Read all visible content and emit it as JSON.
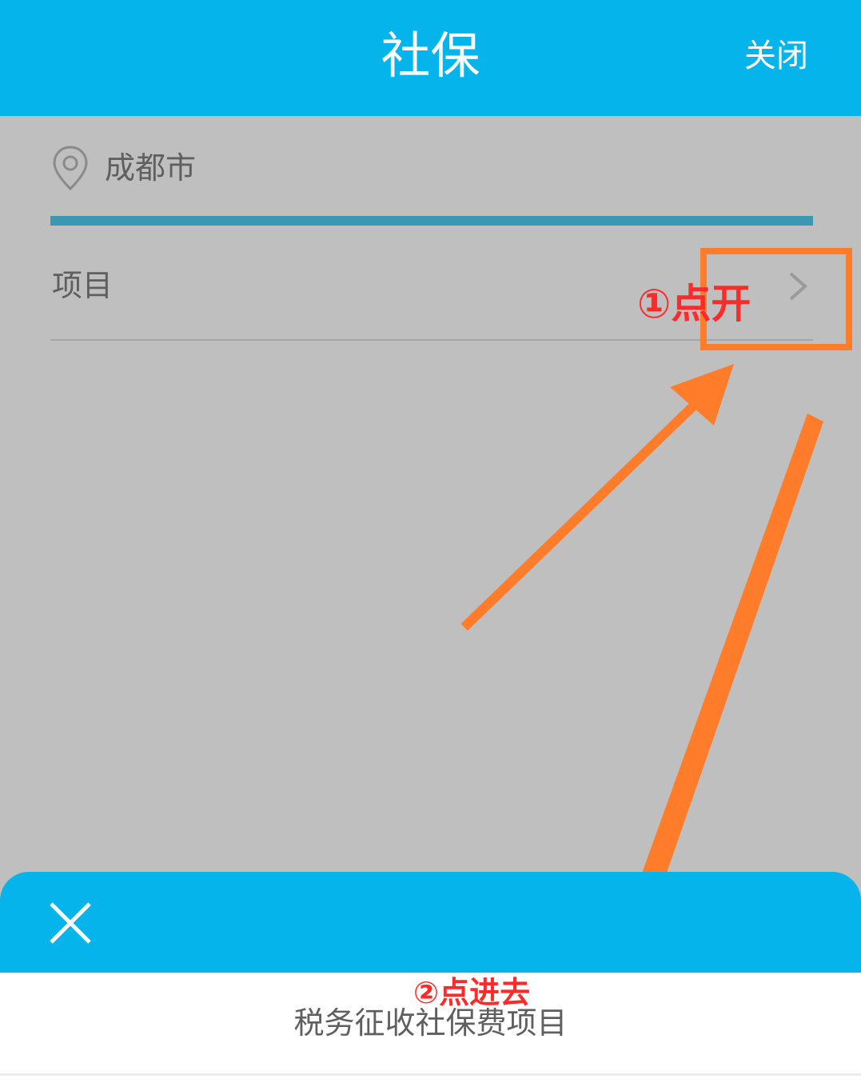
{
  "header": {
    "title": "社保",
    "close_label": "关闭"
  },
  "location": {
    "icon": "map-pin-icon",
    "city": "成都市"
  },
  "form": {
    "project_label": "项目",
    "chevron_icon": "chevron-right-icon"
  },
  "annotations": {
    "step1": "①点开",
    "step2": "②点进去"
  },
  "sheet": {
    "close_icon": "close-icon",
    "option": "税务征收社保费项目"
  },
  "colors": {
    "brand": "#06b4ec",
    "overlay": "#bfbfbf",
    "annotation_orange": "#ff7d2a",
    "annotation_red": "#ff2a2a",
    "tab_underline": "#3c97b3"
  }
}
